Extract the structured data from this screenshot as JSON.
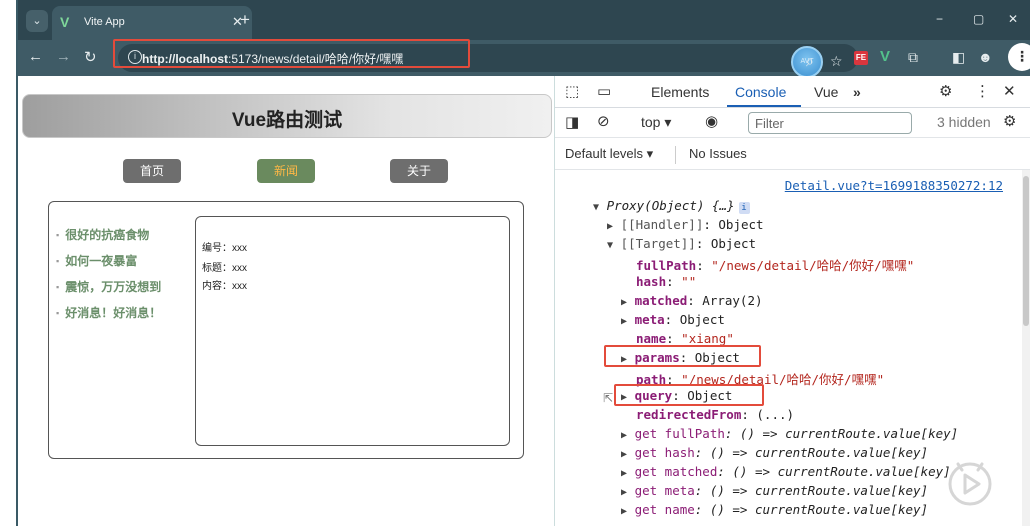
{
  "browser": {
    "tab_title": "Vite App",
    "tab_close": "✕",
    "new_tab": "+",
    "window_controls": [
      "−",
      "▢",
      "✕"
    ],
    "url_host": "http://localhost",
    "url_rest": ":5173/news/detail/哈哈/你好/嘿嘿",
    "nav_icons": [
      "arrow-left-icon",
      "arrow-right-icon",
      "reload-icon"
    ],
    "toolbar_icons": [
      "zoom-icon",
      "star-icon",
      "fe-extension-icon",
      "vue-extension-icon",
      "puzzle-icon",
      "sidebar-icon",
      "profile-icon",
      "more-icon"
    ]
  },
  "page": {
    "header_title": "Vue路由测试",
    "nav": [
      {
        "label": "首页",
        "active": false
      },
      {
        "label": "新闻",
        "active": true
      },
      {
        "label": "关于",
        "active": false
      }
    ],
    "news_list": [
      "很好的抗癌食物",
      "如何一夜暴富",
      "震惊，万万没想到",
      "好消息！好消息！"
    ],
    "detail": {
      "id_line": "编号：xxx",
      "title_line": "标题：xxx",
      "content_line": "内容：xxx"
    }
  },
  "devtools": {
    "tabs": [
      {
        "label": "Elements",
        "active": false
      },
      {
        "label": "Console",
        "active": true
      },
      {
        "label": "Vue",
        "active": false
      }
    ],
    "more_tabs": "»",
    "context": "top",
    "filter_placeholder": "Filter",
    "hidden_count": "3 hidden",
    "default_levels": "Default levels",
    "issues": "No Issues",
    "source_link": "Detail.vue?t=1699188350272:12",
    "console_lines": {
      "proxy": "Proxy(Object) {…}",
      "handler_key": "[[Handler]]",
      "handler_val": ": Object",
      "target_key": "[[Target]]",
      "target_val": ": Object",
      "fullPath_key": "fullPath",
      "fullPath_val": "\"/news/detail/哈哈/你好/嘿嘿\"",
      "hash_key": "hash",
      "hash_val": "\"\"",
      "matched_key": "matched",
      "matched_val": ": Array(2)",
      "meta_key": "meta",
      "meta_val": ": Object",
      "name_key": "name",
      "name_val": "\"xiang\"",
      "params_key": "params",
      "params_val": ": Object",
      "path_key": "path",
      "path_val": "\"/news/detail/哈哈/你好/嘿嘿\"",
      "query_key": "query",
      "query_val": ": Object",
      "redirectedFrom_key": "redirectedFrom",
      "redirectedFrom_val": ": (...)",
      "getters": [
        {
          "key": "get fullPath",
          "val": ": () => currentRoute.value[key]"
        },
        {
          "key": "get hash",
          "val": ": () => currentRoute.value[key]"
        },
        {
          "key": "get matched",
          "val": ": () => currentRoute.value[key]"
        },
        {
          "key": "get meta",
          "val": ": () => currentRoute.value[key]"
        },
        {
          "key": "get name",
          "val": ": () => currentRoute.value[key]"
        }
      ]
    }
  }
}
